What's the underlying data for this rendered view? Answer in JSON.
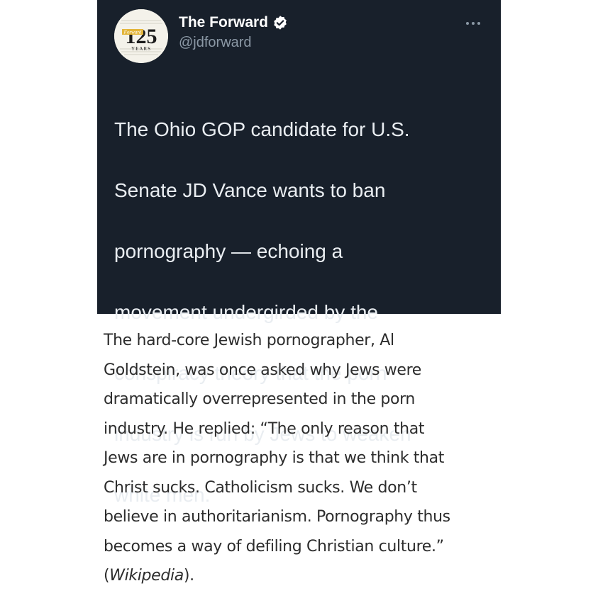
{
  "tweet": {
    "account_name": "The Forward",
    "handle": "@jdforward",
    "avatar": {
      "logo_text": "Forward",
      "anniversary_number": "125",
      "years_label": "YEARS"
    },
    "verified_icon": "verified-badge-icon",
    "more_icon": "more-horizontal-icon",
    "text_lines": [
      "The Ohio GOP candidate for U.S.",
      "Senate JD Vance wants to ban",
      "pornography — echoing a",
      "movement undergirded by the",
      "conspiracy theory that the porn",
      "industry is run by Jews to weaken",
      "white men."
    ]
  },
  "quote": {
    "lines": [
      "The hard-core Jewish pornographer, Al",
      "Goldstein, was once asked why Jews were",
      "dramatically overrepresented in the porn",
      "industry. He replied: “The only reason that",
      "Jews are in pornography is that we think that",
      "Christ sucks. Catholicism sucks. We don’t",
      "believe in authoritarianism. Pornography thus",
      "becomes a way of defiling Christian culture.”"
    ],
    "source_open": "(",
    "source": "Wikipedia",
    "source_close": ")."
  },
  "colors": {
    "card_background": "#18202b",
    "handle_gray": "#8b98a5",
    "verified_blue": "#ffffff",
    "body_text": "#2c2c2c"
  }
}
